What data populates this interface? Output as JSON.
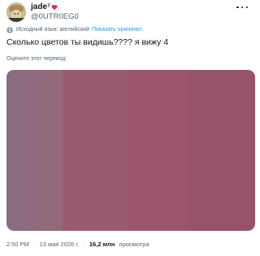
{
  "author": {
    "display_name": "jade⁷",
    "handle": "@0UTR0EG0",
    "avatar_icon": "avatar-image",
    "badge_icon": "red-heart-icon"
  },
  "translation": {
    "source_language": "Исходный язык: английский",
    "show_original_label": "Показать оригинал"
  },
  "tweet": {
    "text": "Сколько цветов ты видишь???? я вижу 4",
    "rate_translation_label": "Оцените этот перевод:"
  },
  "media": {
    "alt": "color gradient stripes",
    "stripes": [
      {
        "color": "#8a6b80",
        "weight": 10
      },
      {
        "color": "#8c6b7e",
        "weight": 7
      },
      {
        "color": "#8e6a7d",
        "weight": 9
      },
      {
        "color": "#906a7e",
        "weight": 8
      },
      {
        "color": "#8e6a7c",
        "weight": 8
      },
      {
        "color": "#926a7c",
        "weight": 7
      },
      {
        "color": "#906b7c",
        "weight": 8
      },
      {
        "color": "#94697c",
        "weight": 7
      },
      {
        "color": "#946a7b",
        "weight": 7
      },
      {
        "color": "#9a5b70",
        "weight": 83
      },
      {
        "color": "#9c566c",
        "weight": 79
      },
      {
        "color": "#96536b",
        "weight": 83
      }
    ]
  },
  "meta": {
    "time": "2:50 PM",
    "date": "13 мая 2026 г.",
    "views_count": "16,2 млн",
    "views_label": "просмотра",
    "separator": "·"
  }
}
